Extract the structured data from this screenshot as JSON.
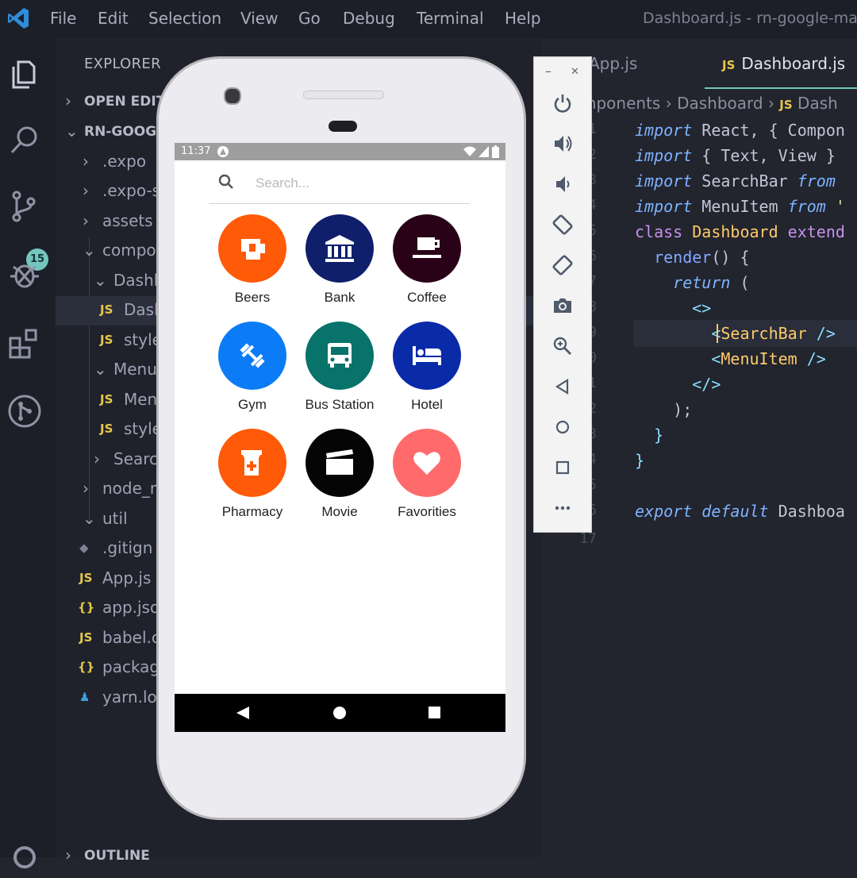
{
  "window": {
    "menus": [
      "File",
      "Edit",
      "Selection",
      "View",
      "Go",
      "Debug",
      "Terminal",
      "Help"
    ],
    "title": "Dashboard.js - rn-google-map"
  },
  "activity_bar": {
    "scm_badge": "15"
  },
  "sidebar": {
    "title": "EXPLORER",
    "open_editors": "OPEN EDIT",
    "project": "RN-GOOG",
    "outline": "OUTLINE",
    "items": [
      {
        "label": ".expo",
        "type": "",
        "chev": "›"
      },
      {
        "label": ".expo-s",
        "type": "",
        "chev": "›"
      },
      {
        "label": "assets",
        "type": "",
        "chev": "›"
      },
      {
        "label": "compo",
        "type": "",
        "chev": "⌄"
      },
      {
        "label": "Dashb",
        "type": "",
        "chev": "⌄"
      },
      {
        "label": "Dash",
        "type": "JS",
        "chev": ""
      },
      {
        "label": "style",
        "type": "JS",
        "chev": ""
      },
      {
        "label": "Menu",
        "type": "",
        "chev": "⌄"
      },
      {
        "label": "Men",
        "type": "JS",
        "chev": ""
      },
      {
        "label": "style",
        "type": "JS",
        "chev": ""
      },
      {
        "label": "Searc",
        "type": "",
        "chev": "›"
      },
      {
        "label": "node_n",
        "type": "",
        "chev": "›"
      },
      {
        "label": "util",
        "type": "",
        "chev": "⌄"
      },
      {
        "label": ".gitign",
        "type": "◆",
        "chev": ""
      },
      {
        "label": "App.js",
        "type": "JS",
        "chev": ""
      },
      {
        "label": "app.jso",
        "type": "{}",
        "chev": ""
      },
      {
        "label": "babel.c",
        "type": "JS",
        "chev": ""
      },
      {
        "label": "packag",
        "type": "{}",
        "chev": ""
      },
      {
        "label": "yarn.lo",
        "type": "♟",
        "chev": ""
      }
    ]
  },
  "editor": {
    "tabs": [
      {
        "label": "App.js",
        "type": ""
      },
      {
        "label": "Dashboard.js",
        "type": "JS"
      }
    ],
    "breadcrumb": [
      "mponents",
      "Dashboard",
      "Dash"
    ],
    "breadcrumb_type": "JS",
    "breadcrumb_sep": "›",
    "line_numbers": [
      "1",
      "2",
      "3",
      "4",
      "5",
      "6",
      "7",
      "8",
      "9",
      "10",
      "11",
      "12",
      "13",
      "14",
      "15",
      "16",
      "17"
    ],
    "code": {
      "l1_a": "import",
      "l1_b": " React, { Compon",
      "l2_a": "import",
      "l2_b": " { Text, View }",
      "l3_a": "import",
      "l3_b": " SearchBar ",
      "l3_c": "from",
      "l4_a": "import",
      "l4_b": " MenuItem ",
      "l4_c": "from",
      "l4_d": " '",
      "l5_a": "class",
      "l5_b": " Dashboard ",
      "l5_c": "extend",
      "l6_a": "  render",
      "l6_b": "() {",
      "l7_a": "    return",
      "l7_b": " (",
      "l8_a": "      <>",
      "l9_a": "        <",
      "l9_b": "SearchBar",
      "l9_c": " />",
      "l10_a": "        <",
      "l10_b": "MenuItem",
      "l10_c": " />",
      "l11_a": "      </>",
      "l12_a": "    );",
      "l13_a": "  }",
      "l14_a": "}",
      "l16_a": "export default",
      "l16_b": " Dashboa"
    }
  },
  "phone": {
    "status_time": "11:37",
    "search_placeholder": "Search...",
    "menu": [
      {
        "label": "Beers",
        "color": "#ff5a08",
        "icon": "beer-icon"
      },
      {
        "label": "Bank",
        "color": "#0f1f6b",
        "icon": "bank-icon"
      },
      {
        "label": "Coffee",
        "color": "#2a0218",
        "icon": "coffee-icon"
      },
      {
        "label": "Gym",
        "color": "#0c7cf6",
        "icon": "dumbbell-icon"
      },
      {
        "label": "Bus Station",
        "color": "#07736b",
        "icon": "bus-icon"
      },
      {
        "label": "Hotel",
        "color": "#0a2ba8",
        "icon": "hotel-icon"
      },
      {
        "label": "Pharmacy",
        "color": "#ff5a08",
        "icon": "pharmacy-icon"
      },
      {
        "label": "Movie",
        "color": "#050505",
        "icon": "movie-icon"
      },
      {
        "label": "Favorities",
        "color": "#ff6b6b",
        "icon": "heart-icon"
      }
    ]
  },
  "emulator_toolbar": {
    "minimize": "–",
    "close": "✕",
    "buttons": [
      "power-icon",
      "volume-up-icon",
      "volume-down-icon",
      "rotate-left-icon",
      "rotate-right-icon",
      "camera-icon",
      "zoom-icon",
      "back-icon",
      "home-icon",
      "overview-icon",
      "more-icon"
    ]
  },
  "colors": {
    "accent": "#73c6be",
    "js": "#e5c84b",
    "json": "#e5c84b"
  }
}
